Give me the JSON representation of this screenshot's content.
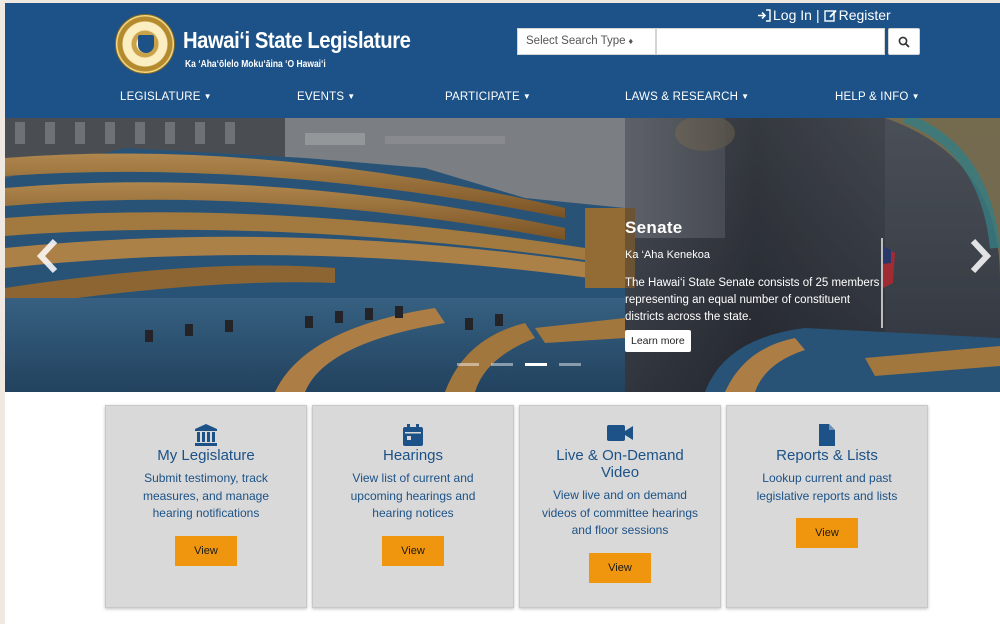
{
  "header": {
    "title": "Hawai‘i State Legislature",
    "subtitle": "Ka ‘Aha‘ōlelo Moku‘āina ‘O Hawai‘i",
    "login_label": "Log In",
    "separator": "|",
    "register_label": "Register",
    "search_type_label": "Select Search Type",
    "search_placeholder": ""
  },
  "nav": {
    "items": [
      {
        "label": "LEGISLATURE"
      },
      {
        "label": "EVENTS"
      },
      {
        "label": "PARTICIPATE"
      },
      {
        "label": "LAWS & RESEARCH"
      },
      {
        "label": "HELP & INFO"
      }
    ]
  },
  "hero": {
    "title": "Senate",
    "subtitle": "Ka ‘Aha Kenekoa",
    "text": "The Hawai‘i State Senate consists of 25 members representing an equal number of constituent districts across the state.",
    "button_label": "Learn more",
    "slide_count": 4,
    "active_slide": 3
  },
  "cards": [
    {
      "icon": "landmark-icon",
      "title": "My Legislature",
      "description": "Submit testimony, track measures, and manage hearing notifications",
      "button": "View"
    },
    {
      "icon": "calendar-icon",
      "title": "Hearings",
      "description": "View list of current and upcoming hearings and hearing notices",
      "button": "View"
    },
    {
      "icon": "video-camera-icon",
      "title": "Live & On-Demand Video",
      "description": "View live and on demand videos of committee hearings and floor sessions",
      "button": "View"
    },
    {
      "icon": "document-icon",
      "title": "Reports & Lists",
      "description": "Lookup current and past legislative reports and lists",
      "button": "View"
    }
  ],
  "colors": {
    "header": "#1c5287",
    "accent": "#f0960e",
    "card_bg": "#d9d9d9",
    "card_text": "#1c5287"
  }
}
